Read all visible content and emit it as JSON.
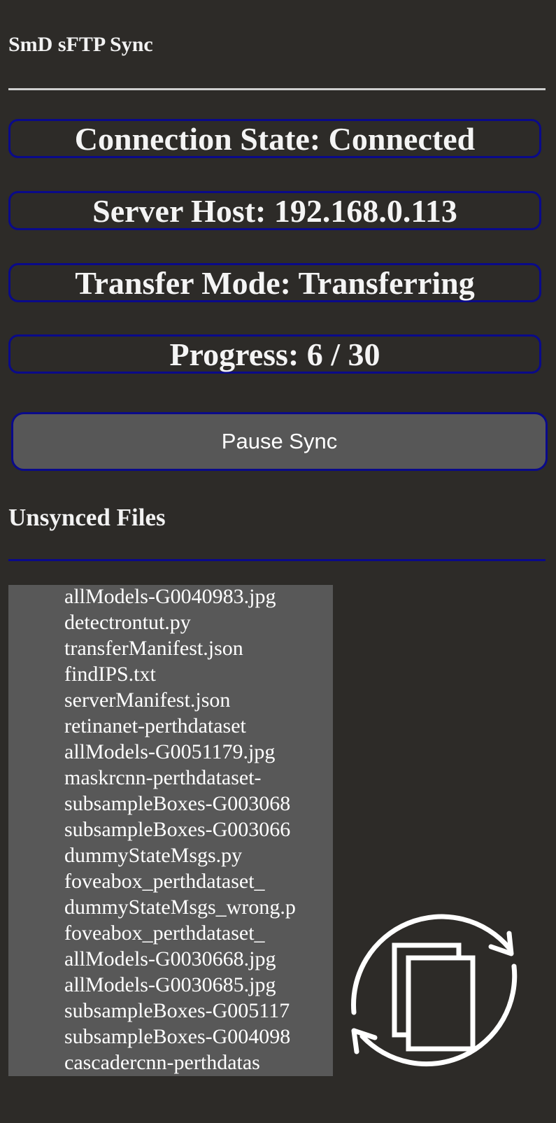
{
  "app": {
    "title": "SmD sFTP Sync"
  },
  "status": {
    "connection": "Connection State: Connected",
    "server_host": "Server Host: 192.168.0.113",
    "transfer_mode": "Transfer Mode: Transferring",
    "progress": "Progress: 6 / 30"
  },
  "controls": {
    "pause_label": "Pause Sync"
  },
  "unsynced": {
    "heading": "Unsynced Files",
    "files": [
      "allModels-G0040983.jpg",
      "detectrontut.py",
      "transferManifest.json",
      "findIPS.txt",
      "serverManifest.json",
      "retinanet-perthdataset",
      "allModels-G0051179.jpg",
      "maskrcnn-perthdataset-",
      "subsampleBoxes-G003068",
      "subsampleBoxes-G003066",
      "dummyStateMsgs.py",
      "foveabox_perthdataset_",
      "dummyStateMsgs_wrong.p",
      "foveabox_perthdataset_",
      "allModels-G0030668.jpg",
      "allModels-G0030685.jpg",
      "subsampleBoxes-G005117",
      "subsampleBoxes-G004098",
      "cascadercnn-perthdatas"
    ]
  },
  "icons": {
    "sync": "file-sync-icon"
  },
  "colors": {
    "background": "#2d2b28",
    "accent_border": "#0a0a8a",
    "button_bg": "#575757",
    "list_bg": "#585858"
  }
}
